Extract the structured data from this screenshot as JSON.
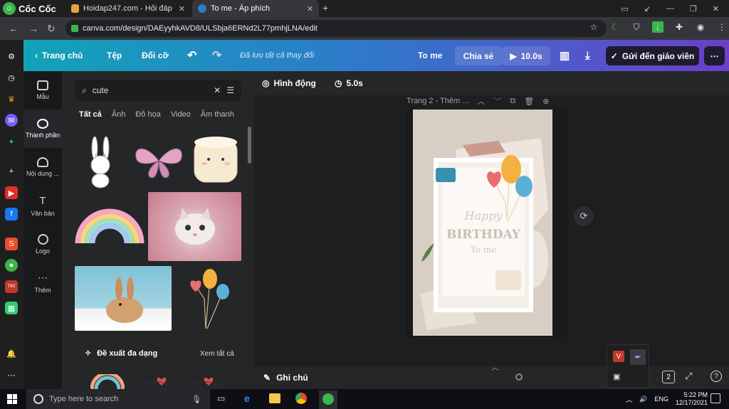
{
  "browser": {
    "brand": "Cốc Cốc",
    "tabs": [
      {
        "title": "Hoidap247.com - Hỏi đáp o",
        "active": false
      },
      {
        "title": "To me - Áp phích",
        "active": true
      }
    ],
    "new_tab": "+",
    "url": "canva.com/design/DAEyyhkAVD8/ULSbja6ERNd2L77pmhjLNA/edit"
  },
  "canva_header": {
    "home": "Trang chủ",
    "file": "Tệp",
    "resize": "Đổi cỡ",
    "saved": "Đã lưu tất cả thay đổi",
    "design_title": "To me",
    "share": "Chia sẻ",
    "play_duration": "10.0s",
    "send_teacher": "Gửi đến giáo viên",
    "more": "⋯"
  },
  "rail": [
    {
      "label": "Mẫu",
      "icon": "template-icon"
    },
    {
      "label": "Thành phần",
      "icon": "elements-icon",
      "active": true
    },
    {
      "label": "Nội dung ...",
      "icon": "upload-icon"
    },
    {
      "label": "Văn bản",
      "icon": "text-icon"
    },
    {
      "label": "Logo",
      "icon": "logo-icon"
    },
    {
      "label": "Thêm",
      "icon": "more-icon"
    }
  ],
  "panel": {
    "search_value": "cute",
    "categories": [
      "Tất cả",
      "Ảnh",
      "Đồ họa",
      "Video",
      "Âm thanh"
    ],
    "section_title": "Đề xuất đa dạng",
    "see_all": "Xem tất cả"
  },
  "editor": {
    "animate": "Hình động",
    "duration": "5.0s",
    "page_label": "Trang 2 - Thêm ...",
    "card_line1": "Happy",
    "card_line2": "BIRTHDAY",
    "card_line3": "To me",
    "notes": "Ghi chú",
    "page_count": "2"
  },
  "taskbar": {
    "search_placeholder": "Type here to search",
    "lang": "ENG",
    "time": "5:22 PM",
    "date": "12/17/2021"
  },
  "colors": {
    "header_gradient_start": "#12a3b8",
    "header_gradient_end": "#6a3fc9",
    "panel_bg": "#252627"
  }
}
